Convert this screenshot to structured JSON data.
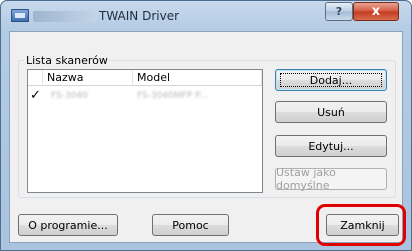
{
  "window": {
    "title": "TWAIN Driver",
    "help_label": "?",
    "close_label": "x"
  },
  "scanner_list": {
    "legend": "Lista skanerów",
    "columns": [
      "",
      "Nazwa",
      "Model"
    ],
    "rows": [
      {
        "checked": "✓",
        "name": "FS-3040",
        "model": "FS-3040MFP P..."
      }
    ]
  },
  "side_buttons": {
    "add": "Dodaj...",
    "remove": "Usuń",
    "edit": "Edytuj...",
    "set_default": "Ustaw jako domyślne"
  },
  "footer_buttons": {
    "about": "O programie...",
    "help": "Pomoc",
    "close": "Zamknij"
  },
  "colors": {
    "highlight": "#e00000"
  }
}
